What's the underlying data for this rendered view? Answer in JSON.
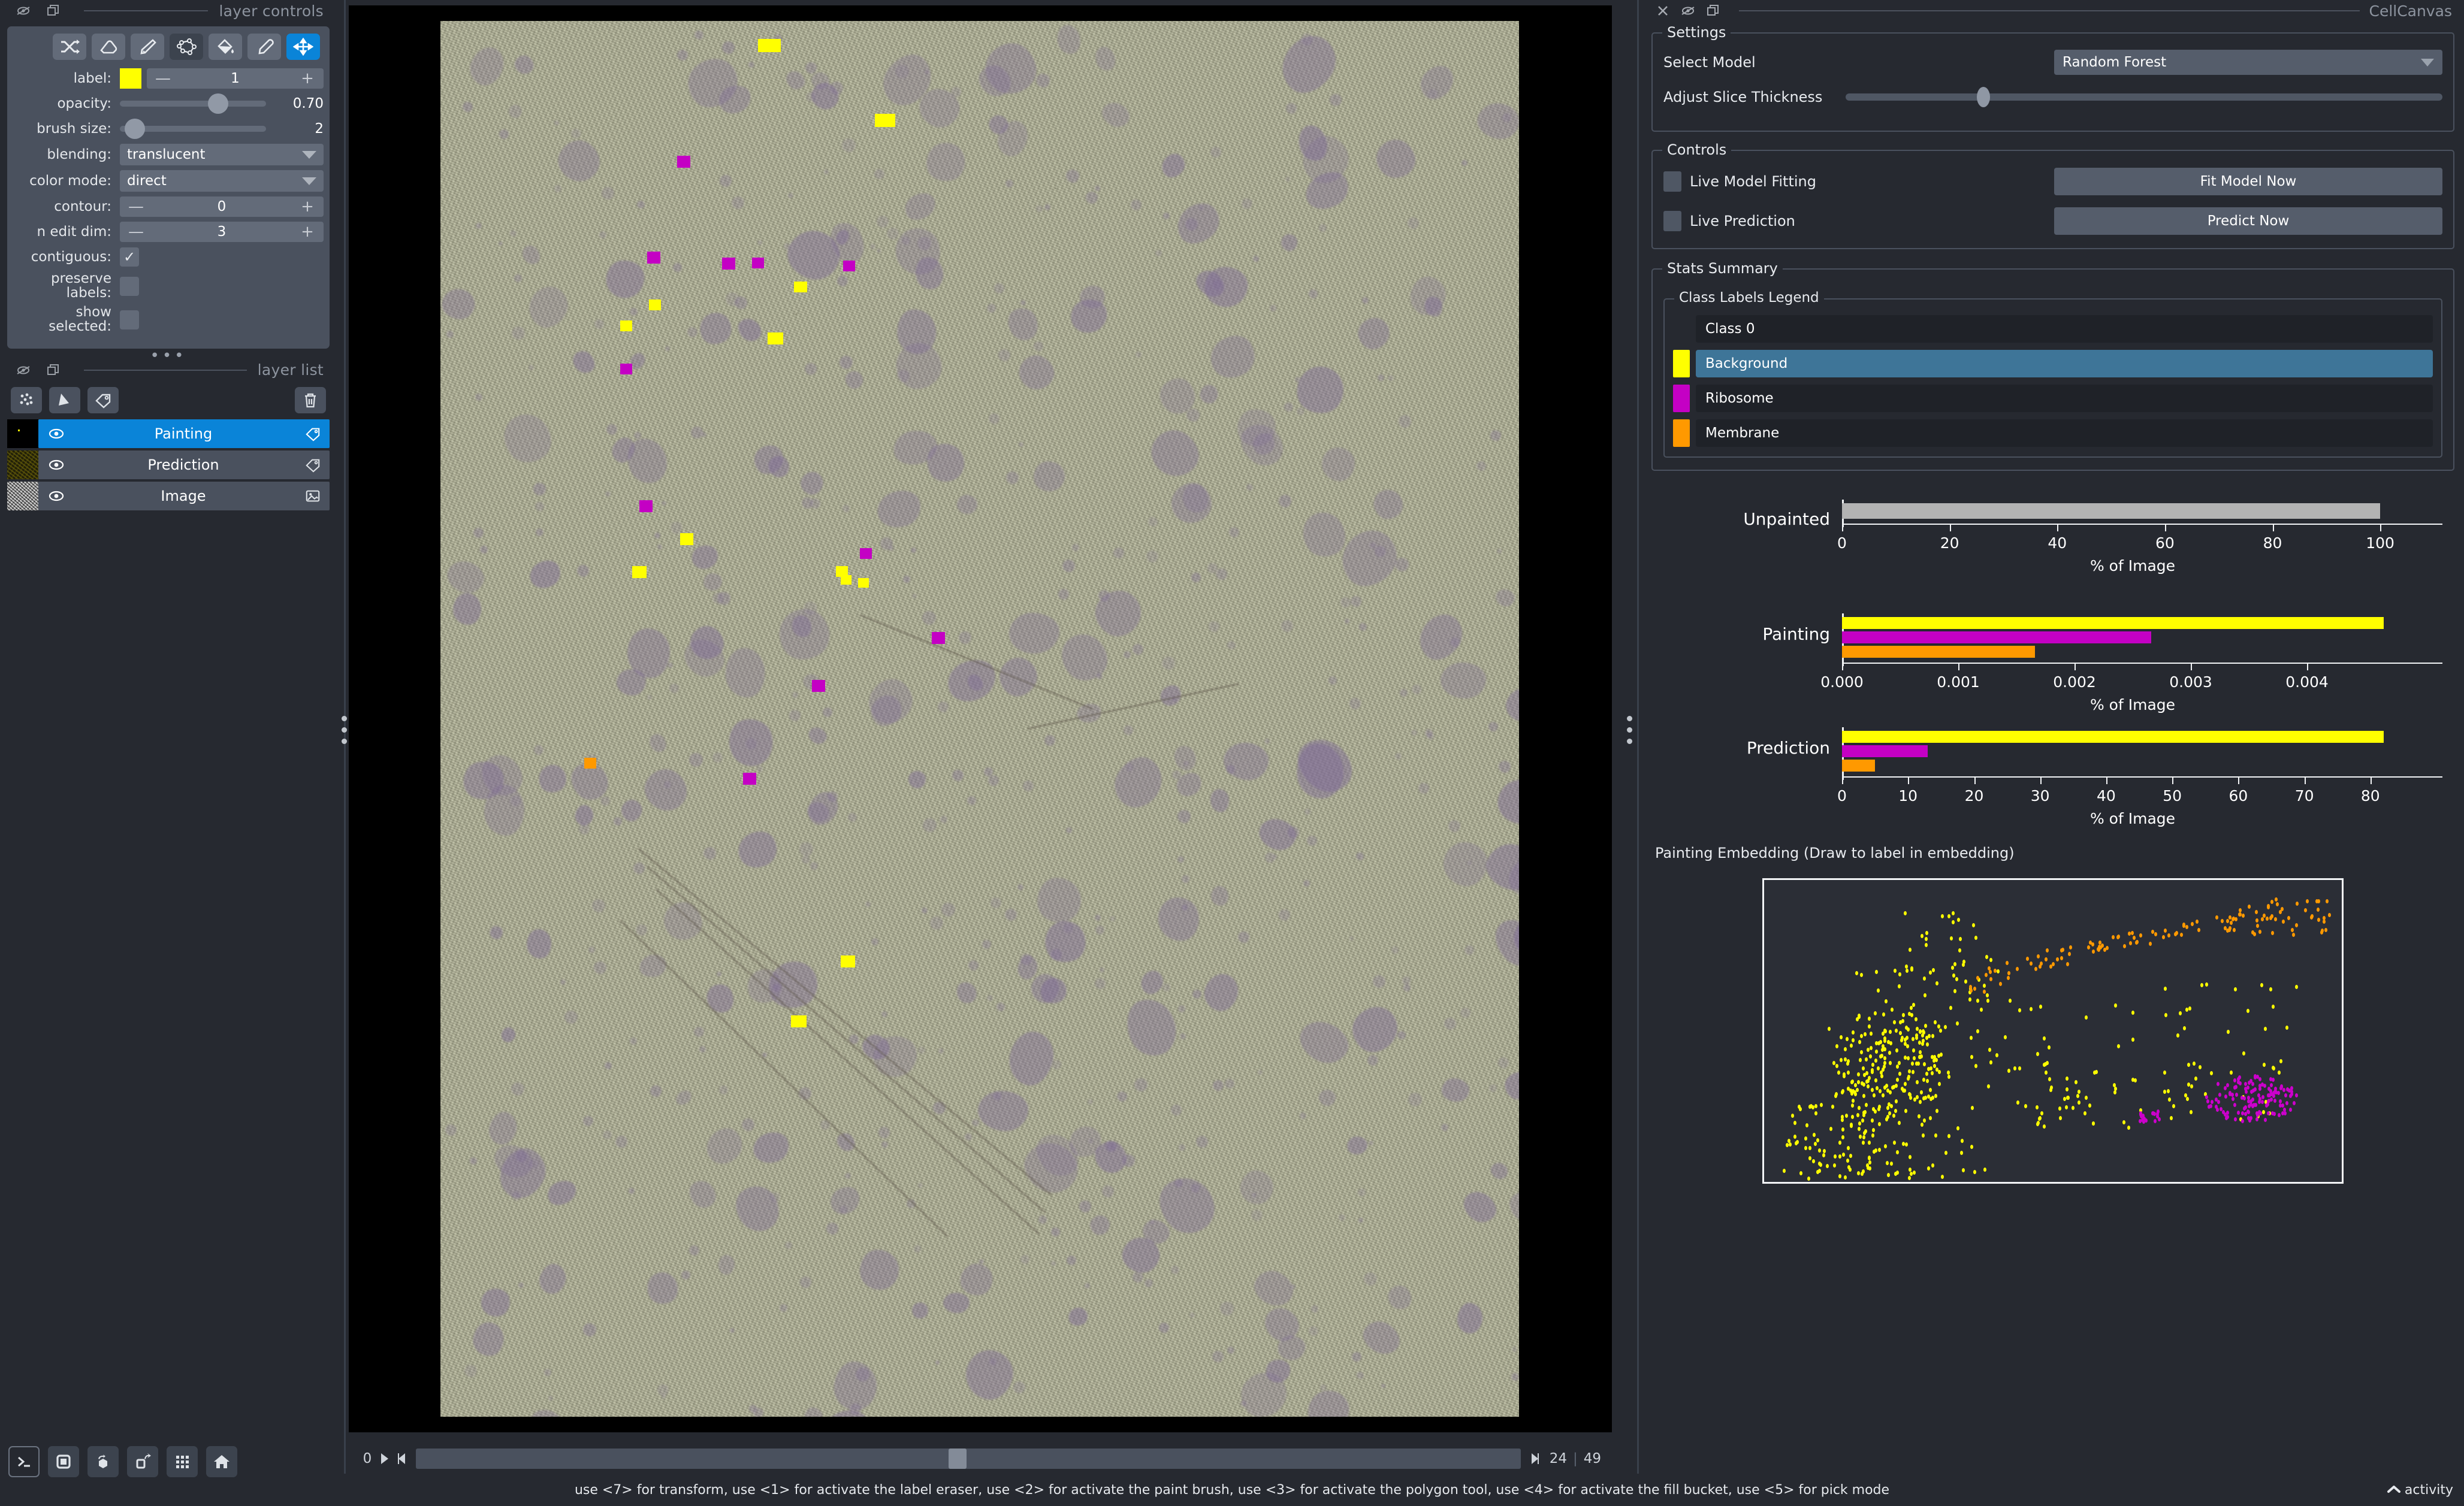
{
  "left_dock": {
    "title": "layer controls",
    "titlebar_icons": [
      "hide-icon",
      "float-icon"
    ],
    "tools": [
      {
        "name": "shuffle-colors-tool",
        "icon": "shuffle-icon",
        "state": "normal"
      },
      {
        "name": "label-eraser-tool",
        "icon": "eraser-icon",
        "state": "normal"
      },
      {
        "name": "paint-brush-tool",
        "icon": "brush-icon",
        "state": "normal"
      },
      {
        "name": "polygon-tool",
        "icon": "polygon-icon",
        "state": "dark"
      },
      {
        "name": "fill-bucket-tool",
        "icon": "fill-bucket-icon",
        "state": "normal"
      },
      {
        "name": "pick-mode-tool",
        "icon": "eyedropper-icon",
        "state": "normal"
      },
      {
        "name": "transform-tool",
        "icon": "move-arrows-icon",
        "state": "active"
      }
    ],
    "controls": {
      "label": {
        "label": "label:",
        "value": "1",
        "swatch_color": "#ffff00",
        "minus": "—",
        "plus": "+"
      },
      "opacity": {
        "label": "opacity:",
        "value": "0.70",
        "fraction": 0.7
      },
      "brush_size": {
        "label": "brush size:",
        "value": "2",
        "fraction": 0.04
      },
      "blending": {
        "label": "blending:",
        "value": "translucent"
      },
      "color_mode": {
        "label": "color mode:",
        "value": "direct"
      },
      "contour": {
        "label": "contour:",
        "value": "0",
        "minus": "—",
        "plus": "+"
      },
      "n_edit_dim": {
        "label": "n edit dim:",
        "value": "3",
        "minus": "—",
        "plus": "+"
      },
      "contiguous": {
        "label": "contiguous:",
        "checked": true,
        "check": "✓"
      },
      "preserve_labels": {
        "label": "preserve labels:",
        "checked": false
      },
      "show_selected": {
        "label": "show selected:",
        "checked": false
      }
    },
    "layer_list": {
      "title": "layer list",
      "tools": [
        {
          "name": "new-points-layer-button",
          "icon": "points-icon"
        },
        {
          "name": "new-shapes-layer-button",
          "icon": "shapes-icon"
        },
        {
          "name": "new-labels-layer-button",
          "icon": "labels-tag-icon"
        },
        {
          "name": "delete-layer-button",
          "icon": "trash-icon"
        }
      ],
      "layers": [
        {
          "name": "Painting",
          "type_icon": "labels-tag-icon",
          "visible": true,
          "selected": true
        },
        {
          "name": "Prediction",
          "type_icon": "labels-tag-icon",
          "visible": true,
          "selected": false
        },
        {
          "name": "Image",
          "type_icon": "image-icon",
          "visible": true,
          "selected": false
        }
      ]
    },
    "viewer_buttons": [
      {
        "name": "console-button",
        "icon": "console-icon"
      },
      {
        "name": "ndisplay-toggle-button",
        "icon": "square-2d-icon"
      },
      {
        "name": "roll-dims-button",
        "icon": "cube-roll-icon"
      },
      {
        "name": "transpose-dims-button",
        "icon": "transpose-icon"
      },
      {
        "name": "grid-view-button",
        "icon": "grid-icon"
      },
      {
        "name": "home-button",
        "icon": "home-icon"
      }
    ]
  },
  "canvas": {
    "slice_slider": {
      "min_label": "0",
      "current": "24",
      "max": "49",
      "separator": "|",
      "fraction": 0.49,
      "play_icon": "play-icon",
      "first_icon": "step-first-icon",
      "last_icon": "step-last-icon"
    }
  },
  "right_dock": {
    "title": "CellCanvas",
    "titlebar_icons": [
      "close-icon",
      "hide-icon",
      "float-icon"
    ],
    "settings": {
      "legend": "Settings",
      "select_model": {
        "label": "Select Model",
        "value": "Random Forest"
      },
      "slice_thickness": {
        "label": "Adjust Slice Thickness",
        "fraction": 0.225
      }
    },
    "controls": {
      "legend": "Controls",
      "live_model_fitting": {
        "label": "Live Model Fitting",
        "checked": false
      },
      "fit_model_now": "Fit Model Now",
      "live_prediction": {
        "label": "Live Prediction",
        "checked": false
      },
      "predict_now": "Predict Now"
    },
    "stats_summary": {
      "legend": "Stats Summary",
      "class_labels_legend": {
        "legend": "Class Labels Legend",
        "classes": [
          {
            "name": "Class 0",
            "color": null,
            "selected": false
          },
          {
            "name": "Background",
            "color": "#ffff00",
            "selected": true
          },
          {
            "name": "Ribosome",
            "color": "#c400c4",
            "selected": false
          },
          {
            "name": "Membrane",
            "color": "#ff9900",
            "selected": false
          }
        ]
      }
    },
    "embedding": {
      "title": "Painting Embedding (Draw to label in embedding)"
    }
  },
  "chart_data": [
    {
      "type": "bar",
      "title": "Unpainted",
      "orientation": "horizontal",
      "categories": [
        "Unpainted"
      ],
      "values": [
        100.0
      ],
      "colors": [
        "#b3b3b3"
      ],
      "xlabel": "% of Image",
      "ylabel": "",
      "xlim": [
        0,
        108
      ],
      "xticks": [
        0,
        20,
        40,
        60,
        80,
        100
      ],
      "xticklabels": [
        "0",
        "20",
        "40",
        "60",
        "80",
        "100"
      ],
      "grid": false,
      "legend": "none"
    },
    {
      "type": "bar",
      "title": "Painting",
      "orientation": "horizontal",
      "categories": [
        "Background",
        "Ribosome",
        "Membrane"
      ],
      "values": [
        0.00466,
        0.00266,
        0.00166
      ],
      "colors": [
        "#ffff00",
        "#c400c4",
        "#ff9900"
      ],
      "xlabel": "% of Image",
      "ylabel": "",
      "xlim": [
        0,
        0.005
      ],
      "xticks": [
        0.0,
        0.001,
        0.002,
        0.003,
        0.004
      ],
      "xticklabels": [
        "0.000",
        "0.001",
        "0.002",
        "0.003",
        "0.004"
      ],
      "grid": false,
      "legend": "none"
    },
    {
      "type": "bar",
      "title": "Prediction",
      "orientation": "horizontal",
      "categories": [
        "Background",
        "Ribosome",
        "Membrane"
      ],
      "values": [
        82.0,
        13.0,
        5.0
      ],
      "colors": [
        "#ffff00",
        "#c400c4",
        "#ff9900"
      ],
      "xlabel": "% of Image",
      "ylabel": "",
      "xlim": [
        0,
        88
      ],
      "xticks": [
        0,
        10,
        20,
        30,
        40,
        50,
        60,
        70,
        80
      ],
      "xticklabels": [
        "0",
        "10",
        "20",
        "30",
        "40",
        "50",
        "60",
        "70",
        "80"
      ],
      "grid": false,
      "legend": "none"
    },
    {
      "type": "scatter",
      "title": "Painting Embedding (Draw to label in embedding)",
      "xlabel": "",
      "ylabel": "",
      "series": [
        {
          "name": "Background",
          "color": "#ffff00",
          "n_points": 420
        },
        {
          "name": "Membrane",
          "color": "#ff9900",
          "n_points": 110
        },
        {
          "name": "Ribosome",
          "color": "#c400c4",
          "n_points": 120
        }
      ],
      "grid": false,
      "legend": "none"
    }
  ],
  "statusbar": {
    "text": "use <7> for transform, use <1> for activate the label eraser, use <2> for activate the paint brush, use <3> for activate the polygon tool, use <4> for activate the fill bucket, use <5> for pick mode",
    "activity_label": "activity",
    "activity_icon": "chevron-up-icon"
  }
}
